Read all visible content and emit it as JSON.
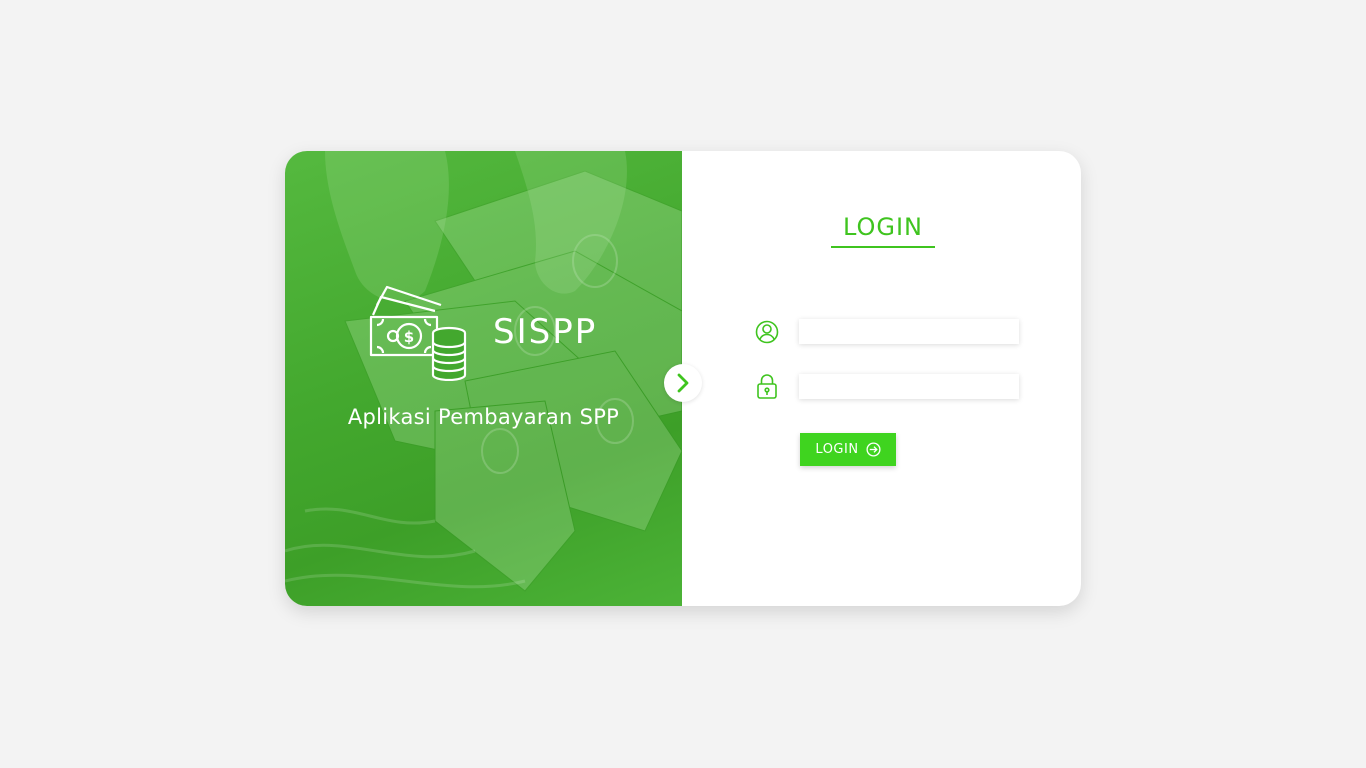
{
  "brand": {
    "name": "SISPP",
    "tagline": "Aplikasi Pembayaran SPP"
  },
  "login": {
    "title": "LOGIN",
    "username_value": "",
    "password_value": "",
    "button_label": "LOGIN"
  },
  "icons": {
    "brand": "money-coins-icon",
    "arrow": "chevron-right-icon",
    "username": "user-circle-icon",
    "password": "padlock-icon",
    "button": "sign-in-arrow-icon"
  },
  "colors": {
    "accent": "#3fc41f",
    "button": "#3fd41f",
    "hero": "#43a82e",
    "background": "#f3f3f3"
  }
}
